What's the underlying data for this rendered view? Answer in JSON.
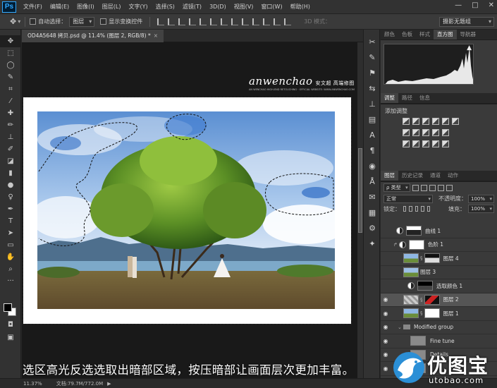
{
  "app": {
    "logo": "Ps",
    "menus": [
      "文件(F)",
      "编辑(E)",
      "图像(I)",
      "图层(L)",
      "文字(Y)",
      "选择(S)",
      "滤镜(T)",
      "3D(D)",
      "视图(V)",
      "窗口(W)",
      "帮助(H)"
    ],
    "window_controls": [
      "—",
      "□",
      "✕"
    ]
  },
  "options": {
    "auto_select_label": "自动选择：",
    "auto_select_value": "图层",
    "show_transform_label": "显示变换控件",
    "mode_3d_label": "3D 模式：",
    "workspace": "摄影无题组"
  },
  "document": {
    "tab_title": "OD4A5648 拷贝.psd @ 11.4% (图层 2, RGB/8) *",
    "tab_close": "×"
  },
  "watermark": {
    "name": "anwenchao",
    "cn": "安文超 高端修图",
    "sub": "AN WENCHAO HIGH-END RETOUCHING · OFFICIAL WEBSITE: WWW.ANWENCHAO.COM"
  },
  "panels": {
    "top_tabs": [
      "颜色",
      "色板",
      "样式",
      "直方图",
      "导航器"
    ],
    "top_active": 3,
    "mid_tabs": [
      "调整",
      "路径",
      "信息"
    ],
    "mid_active": 0,
    "adjust_title": "添加调整",
    "layer_tabs": [
      "图层",
      "历史记录",
      "通道",
      "动作"
    ],
    "layer_active": 0,
    "filter_kind": "ρ 类型",
    "blend_mode": "正常",
    "opacity_label": "不透明度：",
    "opacity_value": "100%",
    "lock_label": "锁定：",
    "fill_label": "填充：",
    "fill_value": "100%"
  },
  "layers": [
    {
      "name": "曲线 1",
      "visible": false,
      "kind": "adjust"
    },
    {
      "name": "色阶 1",
      "visible": false,
      "kind": "adjust-clip"
    },
    {
      "name": "图层 4",
      "visible": false,
      "kind": "pixel-mask"
    },
    {
      "name": "图层 3",
      "visible": false,
      "kind": "pixel"
    },
    {
      "name": "选取颜色 1",
      "visible": false,
      "kind": "adjust-dark"
    },
    {
      "name": "图层 2",
      "visible": true,
      "kind": "pixel-red",
      "selected": true
    },
    {
      "name": "图层 1",
      "visible": true,
      "kind": "pixel-mask"
    },
    {
      "name": "Modified group",
      "visible": true,
      "kind": "group"
    },
    {
      "name": "Fine tune",
      "visible": true,
      "kind": "gray"
    },
    {
      "name": "Details",
      "visible": true,
      "kind": "gray"
    },
    {
      "name": "",
      "visible": true,
      "kind": "gray"
    }
  ],
  "status": {
    "zoom": "11.37%",
    "doc_size": "文档:79.7M/772.0M",
    "arrow": "▶"
  },
  "caption": "选区高光反选选取出暗部区域，按压暗部让画面层次更加丰富。",
  "site": {
    "name": "优图宝",
    "domain": "utobao.com"
  },
  "colors": {
    "accent": "#31a8ff",
    "selected_layer": "#555555",
    "canvas_bg": "#191919"
  }
}
